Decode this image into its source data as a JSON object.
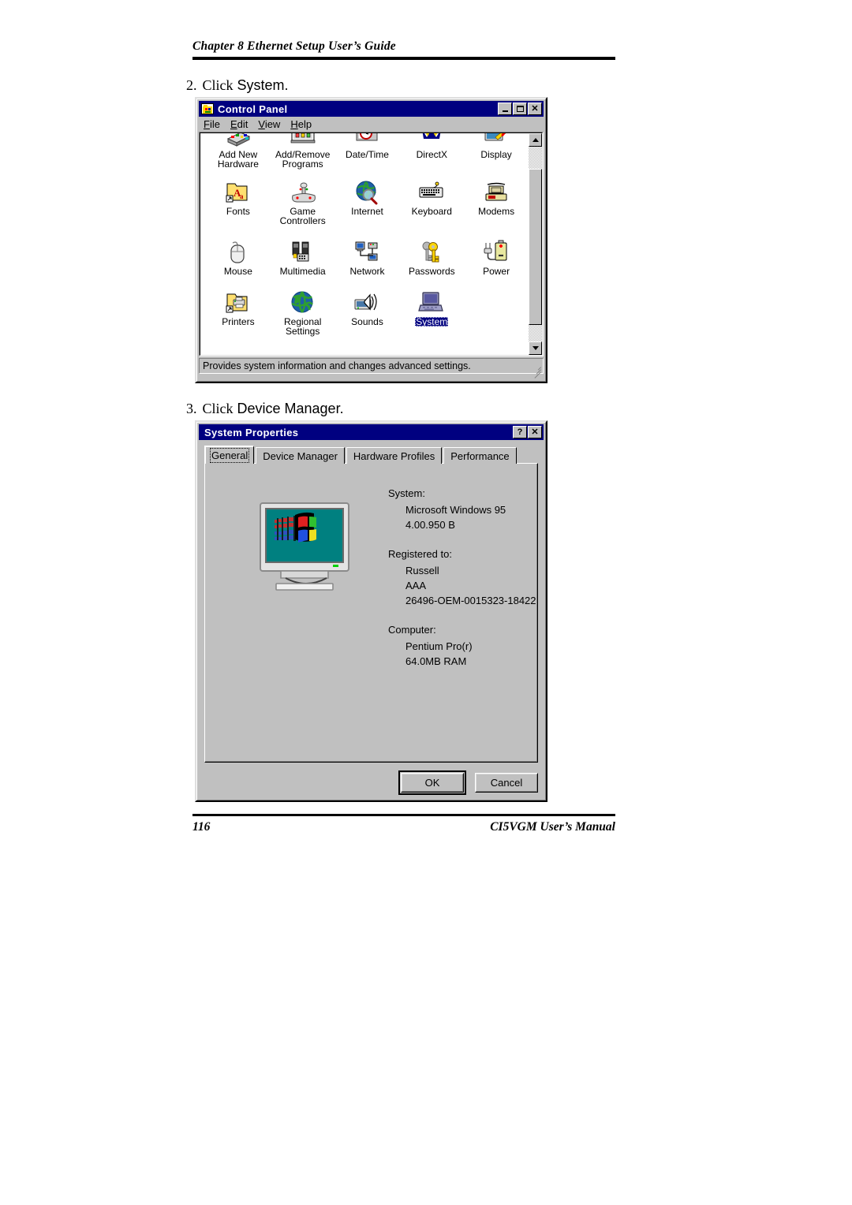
{
  "document": {
    "running_head": "Chapter 8  Ethernet Setup User’s Guide",
    "page_number": "116",
    "manual_title": "CI5VGM User’s Manual"
  },
  "steps": [
    {
      "number": "2.",
      "lead": "Click",
      "text": " System."
    },
    {
      "number": "3.",
      "lead": "Click",
      "text": " Device Manager."
    }
  ],
  "control_panel": {
    "title": "Control Panel",
    "app_icon": "control-panel-icon",
    "window_buttons": {
      "minimize": "minimize-icon",
      "maximize": "maximize-icon",
      "close": "✕"
    },
    "menu": [
      {
        "label": "File",
        "accel": "F"
      },
      {
        "label": "Edit",
        "accel": "E"
      },
      {
        "label": "View",
        "accel": "V"
      },
      {
        "label": "Help",
        "accel": "H"
      }
    ],
    "icons": [
      {
        "label": "Add New\nHardware",
        "icon": "add-new-hardware-icon",
        "selected": false
      },
      {
        "label": "Add/Remove\nPrograms",
        "icon": "add-remove-programs-icon",
        "selected": false
      },
      {
        "label": "Date/Time",
        "icon": "date-time-icon",
        "selected": false
      },
      {
        "label": "DirectX",
        "icon": "directx-icon",
        "selected": false
      },
      {
        "label": "Display",
        "icon": "display-icon",
        "selected": false
      },
      {
        "label": "Fonts",
        "icon": "fonts-icon",
        "selected": false
      },
      {
        "label": "Game\nControllers",
        "icon": "game-controllers-icon",
        "selected": false
      },
      {
        "label": "Internet",
        "icon": "internet-icon",
        "selected": false
      },
      {
        "label": "Keyboard",
        "icon": "keyboard-icon",
        "selected": false
      },
      {
        "label": "Modems",
        "icon": "modems-icon",
        "selected": false
      },
      {
        "label": "Mouse",
        "icon": "mouse-icon",
        "selected": false
      },
      {
        "label": "Multimedia",
        "icon": "multimedia-icon",
        "selected": false
      },
      {
        "label": "Network",
        "icon": "network-icon",
        "selected": false
      },
      {
        "label": "Passwords",
        "icon": "passwords-icon",
        "selected": false
      },
      {
        "label": "Power",
        "icon": "power-icon",
        "selected": false
      },
      {
        "label": "Printers",
        "icon": "printers-icon",
        "selected": false
      },
      {
        "label": "Regional\nSettings",
        "icon": "regional-settings-icon",
        "selected": false
      },
      {
        "label": "Sounds",
        "icon": "sounds-icon",
        "selected": false
      },
      {
        "label": "System",
        "icon": "system-icon",
        "selected": true
      }
    ],
    "status_text": "Provides system information and changes advanced settings."
  },
  "system_properties": {
    "title": "System Properties",
    "window_buttons": {
      "help": "?",
      "close": "✕"
    },
    "tabs": [
      {
        "label": "General",
        "active": true
      },
      {
        "label": "Device Manager",
        "active": false
      },
      {
        "label": "Hardware Profiles",
        "active": false
      },
      {
        "label": "Performance",
        "active": false
      }
    ],
    "general": {
      "system_header": "System:",
      "system_lines": [
        "Microsoft Windows 95",
        "4.00.950 B"
      ],
      "registered_header": "Registered to:",
      "registered_lines": [
        "Russell",
        "AAA",
        "26496-OEM-0015323-18422"
      ],
      "computer_header": "Computer:",
      "computer_lines": [
        "Pentium Pro(r)",
        "64.0MB RAM"
      ],
      "graphic": "windows-logo-monitor"
    },
    "buttons": {
      "ok": "OK",
      "cancel": "Cancel"
    }
  },
  "colors": {
    "titlebar_active": "#000080",
    "face": "#c0c0c0",
    "selection": "#000080",
    "monitor_screen": "#008080"
  }
}
